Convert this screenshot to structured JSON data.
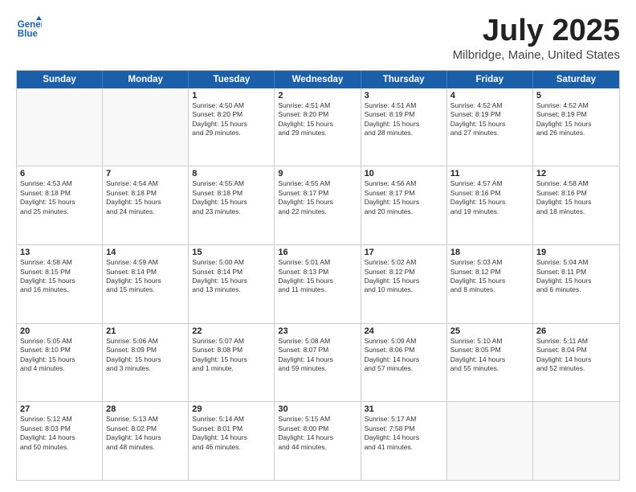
{
  "header": {
    "logo_line1": "General",
    "logo_line2": "Blue",
    "title": "July 2025",
    "subtitle": "Milbridge, Maine, United States"
  },
  "weekdays": [
    "Sunday",
    "Monday",
    "Tuesday",
    "Wednesday",
    "Thursday",
    "Friday",
    "Saturday"
  ],
  "weeks": [
    [
      {
        "num": "",
        "detail": ""
      },
      {
        "num": "",
        "detail": ""
      },
      {
        "num": "1",
        "detail": "Sunrise: 4:50 AM\nSunset: 8:20 PM\nDaylight: 15 hours\nand 29 minutes."
      },
      {
        "num": "2",
        "detail": "Sunrise: 4:51 AM\nSunset: 8:20 PM\nDaylight: 15 hours\nand 29 minutes."
      },
      {
        "num": "3",
        "detail": "Sunrise: 4:51 AM\nSunset: 8:19 PM\nDaylight: 15 hours\nand 28 minutes."
      },
      {
        "num": "4",
        "detail": "Sunrise: 4:52 AM\nSunset: 8:19 PM\nDaylight: 15 hours\nand 27 minutes."
      },
      {
        "num": "5",
        "detail": "Sunrise: 4:52 AM\nSunset: 8:19 PM\nDaylight: 15 hours\nand 26 minutes."
      }
    ],
    [
      {
        "num": "6",
        "detail": "Sunrise: 4:53 AM\nSunset: 8:18 PM\nDaylight: 15 hours\nand 25 minutes."
      },
      {
        "num": "7",
        "detail": "Sunrise: 4:54 AM\nSunset: 8:18 PM\nDaylight: 15 hours\nand 24 minutes."
      },
      {
        "num": "8",
        "detail": "Sunrise: 4:55 AM\nSunset: 8:18 PM\nDaylight: 15 hours\nand 23 minutes."
      },
      {
        "num": "9",
        "detail": "Sunrise: 4:55 AM\nSunset: 8:17 PM\nDaylight: 15 hours\nand 22 minutes."
      },
      {
        "num": "10",
        "detail": "Sunrise: 4:56 AM\nSunset: 8:17 PM\nDaylight: 15 hours\nand 20 minutes."
      },
      {
        "num": "11",
        "detail": "Sunrise: 4:57 AM\nSunset: 8:16 PM\nDaylight: 15 hours\nand 19 minutes."
      },
      {
        "num": "12",
        "detail": "Sunrise: 4:58 AM\nSunset: 8:16 PM\nDaylight: 15 hours\nand 18 minutes."
      }
    ],
    [
      {
        "num": "13",
        "detail": "Sunrise: 4:58 AM\nSunset: 8:15 PM\nDaylight: 15 hours\nand 16 minutes."
      },
      {
        "num": "14",
        "detail": "Sunrise: 4:59 AM\nSunset: 8:14 PM\nDaylight: 15 hours\nand 15 minutes."
      },
      {
        "num": "15",
        "detail": "Sunrise: 5:00 AM\nSunset: 8:14 PM\nDaylight: 15 hours\nand 13 minutes."
      },
      {
        "num": "16",
        "detail": "Sunrise: 5:01 AM\nSunset: 8:13 PM\nDaylight: 15 hours\nand 11 minutes."
      },
      {
        "num": "17",
        "detail": "Sunrise: 5:02 AM\nSunset: 8:12 PM\nDaylight: 15 hours\nand 10 minutes."
      },
      {
        "num": "18",
        "detail": "Sunrise: 5:03 AM\nSunset: 8:12 PM\nDaylight: 15 hours\nand 8 minutes."
      },
      {
        "num": "19",
        "detail": "Sunrise: 5:04 AM\nSunset: 8:11 PM\nDaylight: 15 hours\nand 6 minutes."
      }
    ],
    [
      {
        "num": "20",
        "detail": "Sunrise: 5:05 AM\nSunset: 8:10 PM\nDaylight: 15 hours\nand 4 minutes."
      },
      {
        "num": "21",
        "detail": "Sunrise: 5:06 AM\nSunset: 8:09 PM\nDaylight: 15 hours\nand 3 minutes."
      },
      {
        "num": "22",
        "detail": "Sunrise: 5:07 AM\nSunset: 8:08 PM\nDaylight: 15 hours\nand 1 minute."
      },
      {
        "num": "23",
        "detail": "Sunrise: 5:08 AM\nSunset: 8:07 PM\nDaylight: 14 hours\nand 59 minutes."
      },
      {
        "num": "24",
        "detail": "Sunrise: 5:09 AM\nSunset: 8:06 PM\nDaylight: 14 hours\nand 57 minutes."
      },
      {
        "num": "25",
        "detail": "Sunrise: 5:10 AM\nSunset: 8:05 PM\nDaylight: 14 hours\nand 55 minutes."
      },
      {
        "num": "26",
        "detail": "Sunrise: 5:11 AM\nSunset: 8:04 PM\nDaylight: 14 hours\nand 52 minutes."
      }
    ],
    [
      {
        "num": "27",
        "detail": "Sunrise: 5:12 AM\nSunset: 8:03 PM\nDaylight: 14 hours\nand 50 minutes."
      },
      {
        "num": "28",
        "detail": "Sunrise: 5:13 AM\nSunset: 8:02 PM\nDaylight: 14 hours\nand 48 minutes."
      },
      {
        "num": "29",
        "detail": "Sunrise: 5:14 AM\nSunset: 8:01 PM\nDaylight: 14 hours\nand 46 minutes."
      },
      {
        "num": "30",
        "detail": "Sunrise: 5:15 AM\nSunset: 8:00 PM\nDaylight: 14 hours\nand 44 minutes."
      },
      {
        "num": "31",
        "detail": "Sunrise: 5:17 AM\nSunset: 7:58 PM\nDaylight: 14 hours\nand 41 minutes."
      },
      {
        "num": "",
        "detail": ""
      },
      {
        "num": "",
        "detail": ""
      }
    ]
  ]
}
